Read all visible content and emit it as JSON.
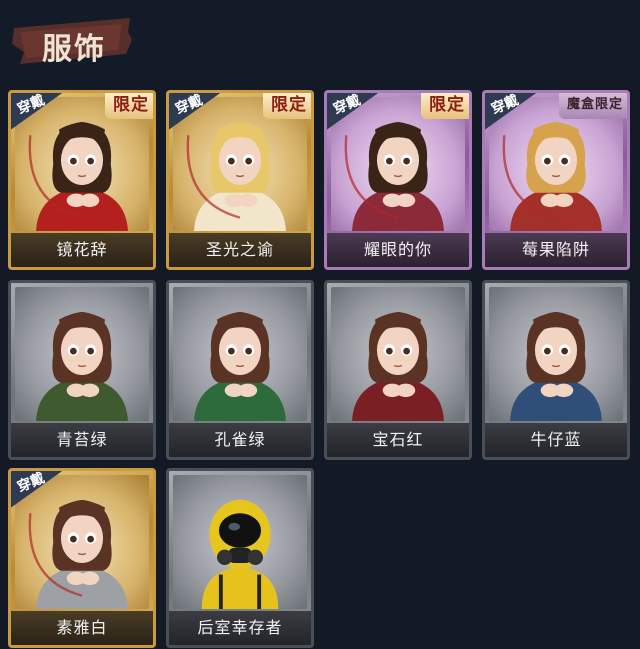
{
  "header": {
    "title": "服饰"
  },
  "tags": {
    "equipped": "穿戴",
    "limited": "限定",
    "box_limited": "魔盒限定"
  },
  "colors": {
    "gold_frame": "#c99a3f",
    "purple_frame": "#a77cb7",
    "grey_frame": "#4a4f56",
    "equip_tag": "#2e3a52",
    "limited_text": "#8a1e14",
    "background": "#131a26"
  },
  "costumes": [
    {
      "name": "镜花辞",
      "rarity": "gold",
      "equipped": true,
      "limited": "限定",
      "outfit_color": "#b3201e",
      "hair_color": "#3a2418"
    },
    {
      "name": "圣光之谕",
      "rarity": "gold",
      "equipped": true,
      "limited": "限定",
      "outfit_color": "#f1e6c9",
      "hair_color": "#e8c66a"
    },
    {
      "name": "耀眼的你",
      "rarity": "purple",
      "equipped": true,
      "limited": "限定",
      "outfit_color": "#8c2a3a",
      "hair_color": "#3a2418"
    },
    {
      "name": "莓果陷阱",
      "rarity": "purple",
      "equipped": true,
      "limited": "魔盒限定",
      "outfit_color": "#a4302a",
      "hair_color": "#d7a24c"
    },
    {
      "name": "青苔绿",
      "rarity": "grey",
      "equipped": false,
      "limited": "",
      "outfit_color": "#3f5a2e",
      "hair_color": "#5a3324"
    },
    {
      "name": "孔雀绿",
      "rarity": "grey",
      "equipped": false,
      "limited": "",
      "outfit_color": "#2d6b3c",
      "hair_color": "#5a3324"
    },
    {
      "name": "宝石红",
      "rarity": "grey",
      "equipped": false,
      "limited": "",
      "outfit_color": "#7a2024",
      "hair_color": "#5a3324"
    },
    {
      "name": "牛仔蓝",
      "rarity": "grey",
      "equipped": false,
      "limited": "",
      "outfit_color": "#2f4f78",
      "hair_color": "#5a3324"
    },
    {
      "name": "素雅白",
      "rarity": "gold",
      "equipped": true,
      "limited": "",
      "outfit_color": "#9da0a5",
      "hair_color": "#5a3324"
    },
    {
      "name": "后室幸存者",
      "rarity": "grey",
      "equipped": false,
      "limited": "",
      "outfit_color": "#e6c21c",
      "hair_color": "#111111"
    }
  ]
}
